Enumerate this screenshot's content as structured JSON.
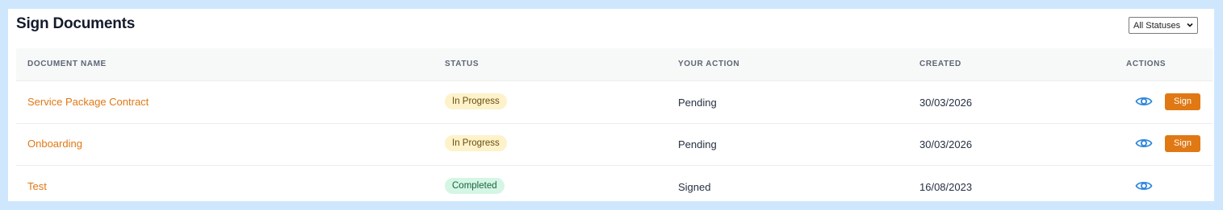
{
  "page": {
    "title": "Sign Documents"
  },
  "filter": {
    "selected": "All Statuses",
    "icon": "chevron-down-icon"
  },
  "table": {
    "headers": {
      "document_name": "DOCUMENT NAME",
      "status": "STATUS",
      "your_action": "YOUR ACTION",
      "created": "CREATED",
      "actions": "ACTIONS"
    },
    "rows": [
      {
        "document_name": "Service Package Contract",
        "status": "In Progress",
        "your_action": "Pending",
        "created": "30/03/2026",
        "view_icon": "eye-icon",
        "sign_label": "Sign"
      },
      {
        "document_name": "Onboarding",
        "status": "In Progress",
        "your_action": "Pending",
        "created": "30/03/2026",
        "view_icon": "eye-icon",
        "sign_label": "Sign"
      },
      {
        "document_name": "Test",
        "status": "Completed",
        "your_action": "Signed",
        "created": "16/08/2023",
        "view_icon": "eye-icon"
      }
    ]
  },
  "colors": {
    "background": "#cfe7fd",
    "accent": "#e07814",
    "in_progress_badge": "#fdf2c9",
    "completed_badge": "#d5f6e5",
    "eye_icon": "#2f86dd"
  }
}
